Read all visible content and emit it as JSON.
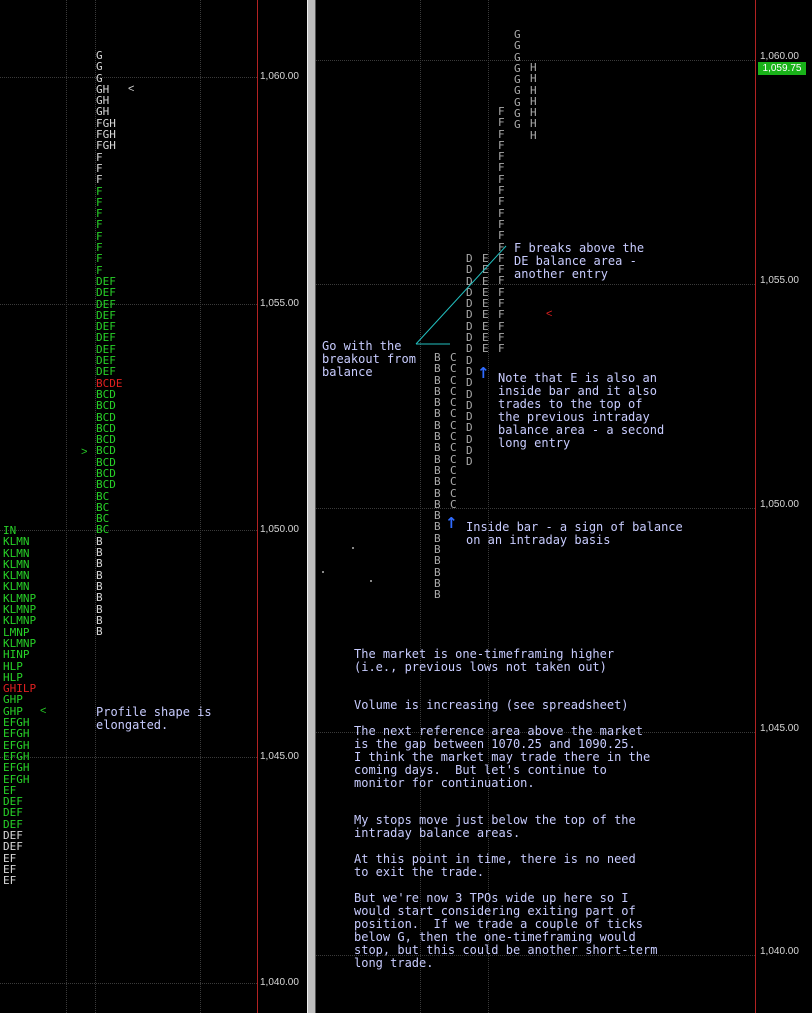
{
  "colors": {
    "green": "#27d127",
    "white": "#d8d8d8",
    "red": "#e02020",
    "annotation": "#c8ccff",
    "arrow": "#2f6bff",
    "last_price_bg": "#19b219"
  },
  "left_axis": {
    "labels": [
      "1,060.00",
      "1,055.00",
      "1,050.00",
      "1,045.00",
      "1,040.00"
    ]
  },
  "right_axis": {
    "labels": [
      "1,060.00",
      "1,055.00",
      "1,050.00",
      "1,045.00",
      "1,040.00"
    ],
    "last_price": "1,059.75"
  },
  "left_profile_main": [
    {
      "t": "G",
      "c": "white"
    },
    {
      "t": "G",
      "c": "white"
    },
    {
      "t": "G",
      "c": "white"
    },
    {
      "t": "GH",
      "c": "white"
    },
    {
      "t": "GH",
      "c": "white"
    },
    {
      "t": "GH",
      "c": "white"
    },
    {
      "t": "FGH",
      "c": "white"
    },
    {
      "t": "FGH",
      "c": "white"
    },
    {
      "t": "FGH",
      "c": "white"
    },
    {
      "t": "F",
      "c": "white"
    },
    {
      "t": "F",
      "c": "white"
    },
    {
      "t": "F",
      "c": "white"
    },
    {
      "t": "F",
      "c": "green"
    },
    {
      "t": "F",
      "c": "green"
    },
    {
      "t": "F",
      "c": "green"
    },
    {
      "t": "F",
      "c": "green"
    },
    {
      "t": "F",
      "c": "green"
    },
    {
      "t": "F",
      "c": "green"
    },
    {
      "t": "F",
      "c": "green"
    },
    {
      "t": "F",
      "c": "green"
    },
    {
      "t": "DEF",
      "c": "green"
    },
    {
      "t": "DEF",
      "c": "green"
    },
    {
      "t": "DEF",
      "c": "green"
    },
    {
      "t": "DEF",
      "c": "green"
    },
    {
      "t": "DEF",
      "c": "green"
    },
    {
      "t": "DEF",
      "c": "green"
    },
    {
      "t": "DEF",
      "c": "green"
    },
    {
      "t": "DEF",
      "c": "green"
    },
    {
      "t": "DEF",
      "c": "green"
    },
    {
      "t": "BCDE",
      "c": "red"
    },
    {
      "t": "BCD",
      "c": "green"
    },
    {
      "t": "BCD",
      "c": "green"
    },
    {
      "t": "BCD",
      "c": "green"
    },
    {
      "t": "BCD",
      "c": "green"
    },
    {
      "t": "BCD",
      "c": "green"
    },
    {
      "t": "BCD",
      "c": "green"
    },
    {
      "t": "BCD",
      "c": "green"
    },
    {
      "t": "BCD",
      "c": "green"
    },
    {
      "t": "BCD",
      "c": "green"
    },
    {
      "t": "BC",
      "c": "green"
    },
    {
      "t": "BC",
      "c": "green"
    },
    {
      "t": "BC",
      "c": "green"
    },
    {
      "t": "BC",
      "c": "green"
    },
    {
      "t": "B",
      "c": "white"
    },
    {
      "t": "B",
      "c": "white"
    },
    {
      "t": "B",
      "c": "white"
    },
    {
      "t": "B",
      "c": "white"
    },
    {
      "t": "B",
      "c": "white"
    },
    {
      "t": "B",
      "c": "white"
    },
    {
      "t": "B",
      "c": "white"
    },
    {
      "t": "B",
      "c": "white"
    },
    {
      "t": "B",
      "c": "white"
    }
  ],
  "left_profile_edge": [
    {
      "t": "IN",
      "c": "green"
    },
    {
      "t": "KLMN",
      "c": "green"
    },
    {
      "t": "KLMN",
      "c": "green"
    },
    {
      "t": "KLMN",
      "c": "green"
    },
    {
      "t": "KLMN",
      "c": "green"
    },
    {
      "t": "KLMN",
      "c": "green"
    },
    {
      "t": "KLMNP",
      "c": "green"
    },
    {
      "t": "KLMNP",
      "c": "green"
    },
    {
      "t": "KLMNP",
      "c": "green"
    },
    {
      "t": "LMNP",
      "c": "green"
    },
    {
      "t": "KLMNP",
      "c": "green"
    },
    {
      "t": "HINP",
      "c": "green"
    },
    {
      "t": "HLP",
      "c": "green"
    },
    {
      "t": "HLP",
      "c": "green"
    },
    {
      "t": "GHILP",
      "c": "red"
    },
    {
      "t": "GHP",
      "c": "green"
    },
    {
      "t": "GHP",
      "c": "green"
    },
    {
      "t": "EFGH",
      "c": "green"
    },
    {
      "t": "EFGH",
      "c": "green"
    },
    {
      "t": "EFGH",
      "c": "green"
    },
    {
      "t": "EFGH",
      "c": "green"
    },
    {
      "t": "EFGH",
      "c": "green"
    },
    {
      "t": "EFGH",
      "c": "green"
    },
    {
      "t": "EF",
      "c": "green"
    },
    {
      "t": "DEF",
      "c": "green"
    },
    {
      "t": "DEF",
      "c": "green"
    },
    {
      "t": "DEF",
      "c": "green"
    },
    {
      "t": "DEF",
      "c": "white"
    },
    {
      "t": "DEF",
      "c": "white"
    },
    {
      "t": "EF",
      "c": "white"
    },
    {
      "t": "EF",
      "c": "white"
    },
    {
      "t": "EF",
      "c": "white"
    }
  ],
  "left_markers": {
    "top": "<",
    "mid": ">",
    "low": "<"
  },
  "left_note": "Profile shape is\nelongated.",
  "right_columns": [
    {
      "id": "col-b",
      "letters": "BBBBBBBBBBBBBBBBBBBBBB"
    },
    {
      "id": "col-c",
      "letters": "CCCCCCCCCCCCCC"
    },
    {
      "id": "col-d",
      "letters": "DDDDDDDDDDDDDDDDDDD"
    },
    {
      "id": "col-e",
      "letters": "EEEEEEEEE"
    },
    {
      "id": "col-f",
      "letters": "FFFFFFFFFFFFFFFFFFFFFF"
    },
    {
      "id": "col-g",
      "letters": "GGGGGGGGG"
    },
    {
      "id": "col-h",
      "letters": "HHHHHHH"
    }
  ],
  "right_marker": "<",
  "annotations": {
    "breakout": "Go with the\nbreakout from\nbalance",
    "f_breaks": "F breaks above the\nDE balance area -\nanother entry",
    "note_e": "Note that E is also an\ninside bar and it also\ntrades to the top of\nthe previous intraday\nbalance area - a second\nlong entry",
    "inside_bar": "Inside bar - a sign of balance\non an intraday basis",
    "one_tf": "The market is one-timeframing higher\n(i.e., previous lows not taken out)",
    "volume": "Volume is increasing (see spreadsheet)",
    "next_ref": "The next reference area above the market\nis the gap between 1070.25 and 1090.25.\nI think the market may trade there in the\ncoming days.  But let's continue to\nmonitor for continuation.",
    "stops": "My stops move just below the top of the\nintraday balance areas.",
    "no_need": "At this point in time, there is no need\nto exit the trade.",
    "tpos_wide": "But we're now 3 TPOs wide up here so I\nwould start considering exiting part of\nposition.  If we trade a couple of ticks\nbelow G, then the one-timeframing would\nstop, but this could be another short-term\nlong trade."
  }
}
